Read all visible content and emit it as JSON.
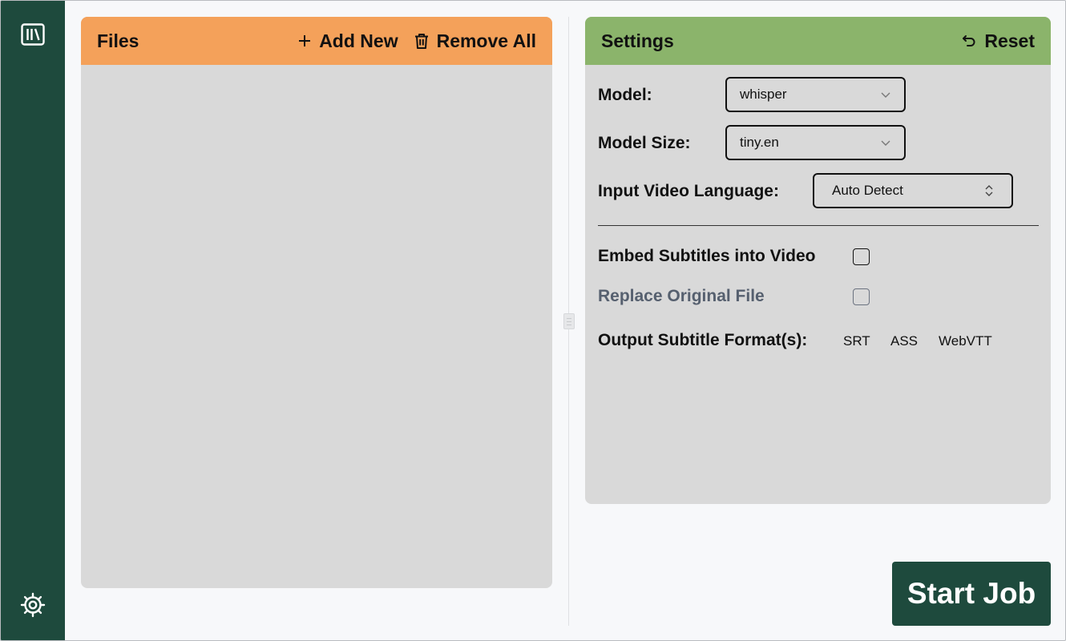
{
  "sidebar": {
    "top_icon": "library-icon",
    "bottom_icon": "gear-icon"
  },
  "files": {
    "title": "Files",
    "add_new_label": "Add New",
    "remove_all_label": "Remove All",
    "header_color": "#f4a15a"
  },
  "settings": {
    "title": "Settings",
    "reset_label": "Reset",
    "header_color": "#8bb46b",
    "model_label": "Model:",
    "model_value": "whisper",
    "model_size_label": "Model Size:",
    "model_size_value": "tiny.en",
    "language_label": "Input Video Language:",
    "language_value": "Auto Detect",
    "embed_label": "Embed Subtitles into Video",
    "replace_label": "Replace Original File",
    "output_format_label": "Output Subtitle Format(s):",
    "formats": [
      "SRT",
      "ASS",
      "WebVTT"
    ]
  },
  "actions": {
    "start_job_label": "Start Job"
  },
  "colors": {
    "sidebar": "#1e4a3d",
    "panel_body": "#d9d9d9",
    "background": "#f7f8fa"
  }
}
